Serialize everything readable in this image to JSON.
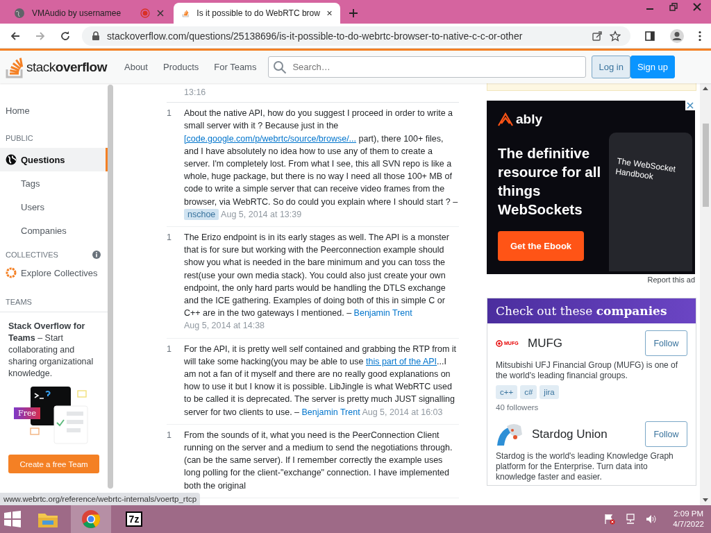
{
  "browser": {
    "tabs": [
      {
        "title": "VMAudio by usernamee",
        "selected": false,
        "recording": true
      },
      {
        "title": "Is it possible to do WebRTC brow",
        "selected": true,
        "recording": false
      }
    ],
    "url": "stackoverflow.com/questions/25138696/is-it-possible-to-do-webrtc-browser-to-native-c-c-or-other",
    "status_url": "www.webrtc.org/reference/webrtc-internals/voertp_rtcp"
  },
  "header": {
    "logo_light": "stack",
    "logo_bold": "overflow",
    "nav": [
      "About",
      "Products",
      "For Teams"
    ],
    "search_placeholder": "Search…",
    "login": "Log in",
    "signup": "Sign up"
  },
  "sidebar": {
    "home": "Home",
    "public_heading": "PUBLIC",
    "public_items": [
      {
        "label": "Questions",
        "selected": true
      },
      {
        "label": "Tags",
        "selected": false
      },
      {
        "label": "Users",
        "selected": false
      },
      {
        "label": "Companies",
        "selected": false
      }
    ],
    "collectives_heading": "COLLECTIVES",
    "collectives_link": "Explore Collectives",
    "teams_heading": "TEAMS",
    "teams_text": "**Stack Overflow for Teams** – Start collaborating and sharing organizational knowledge.",
    "teams_badge": "Free",
    "teams_button": "Create a free Team"
  },
  "previous_comment_tail": "13:16",
  "comments": [
    {
      "score": "1",
      "parts": [
        {
          "text": "About the native API, how do you suggest I proceed in order to write a small server with it ? Because just in the ",
          "link": false
        },
        {
          "text": "[code.google.com/p/webrtc/source/browse/...",
          "link": true
        },
        {
          "text": " part), there 100+ files, and I have absolutely no idea how to use any of them to create a server. I'm completely lost. From what I see, this all SVN repo is like a whole, huge package, but there is no way I need all those 100+ MB of code to write a simple server that can receive video frames from the browser, via WebRTC. So do could you explain where I should start ? –",
          "link": false
        }
      ],
      "author": "nschoe",
      "op": true,
      "date": "Aug 5, 2014 at 13:39"
    },
    {
      "score": "1",
      "parts": [
        {
          "text": "The Erizo endpoint is in its early stages as well. The API is a monster that is for sure but working with the Peerconnection example should show you what is needed in the bare minimum and you can toss the rest(use your own media stack). You could also just create your own endpoint, the only hard parts would be handling the DTLS exchange and the ICE gathering. Examples of doing both of this in simple C or C++ are in the two gateways I mentioned. –",
          "link": false
        }
      ],
      "author": "Benjamin Trent",
      "op": false,
      "date": "Aug 5, 2014 at 14:38"
    },
    {
      "score": "1",
      "parts": [
        {
          "text": "For the API, it is pretty well self contained and grabbing the RTP from it will take some hacking(you may be able to use ",
          "link": false
        },
        {
          "text": "this part of the API",
          "link": true
        },
        {
          "text": "...I am not a fan of it myself and there are no really good explanations on how to use it but I know it is possible. LibJingle is what WebRTC used to be called it is deprecated. The server is pretty much JUST signalling server for two clients to use. –",
          "link": false
        }
      ],
      "author": "Benjamin Trent",
      "op": false,
      "date": "Aug 5, 2014 at 16:03"
    },
    {
      "score": "1",
      "parts": [
        {
          "text": "From the sounds of it, what you need is the PeerConnection Client running on the server and a medium to send the negotiations through. (can be the same server). If I remember correctly the example uses long polling for the client-\"exchange\" connection. I have implemented both the original",
          "link": false
        }
      ]
    }
  ],
  "ad": {
    "brand": "ably",
    "headline": "The definitive resource for all things WebSockets",
    "cta": "Get the Ebook",
    "book_title": "The WebSocket Handbook",
    "report": "Report this ad"
  },
  "companies": {
    "title": "Check out these **companies**",
    "items": [
      {
        "logo_text": "MUFG",
        "name": "MUFG",
        "follow": "Follow",
        "description": "Mitsubishi UFJ Financial Group (MUFG) is one of the world's leading financial groups.",
        "tags": [
          "c++",
          "c#",
          "jira"
        ],
        "followers": "40 followers"
      },
      {
        "name": "Stardog Union",
        "follow": "Follow",
        "description": "Stardog is the world's leading Knowledge Graph platform for the Enterprise. Turn data into knowledge faster and easier."
      }
    ]
  },
  "taskbar": {
    "app_7z": "7z",
    "time": "2:09 PM",
    "date": "4/7/2022"
  }
}
